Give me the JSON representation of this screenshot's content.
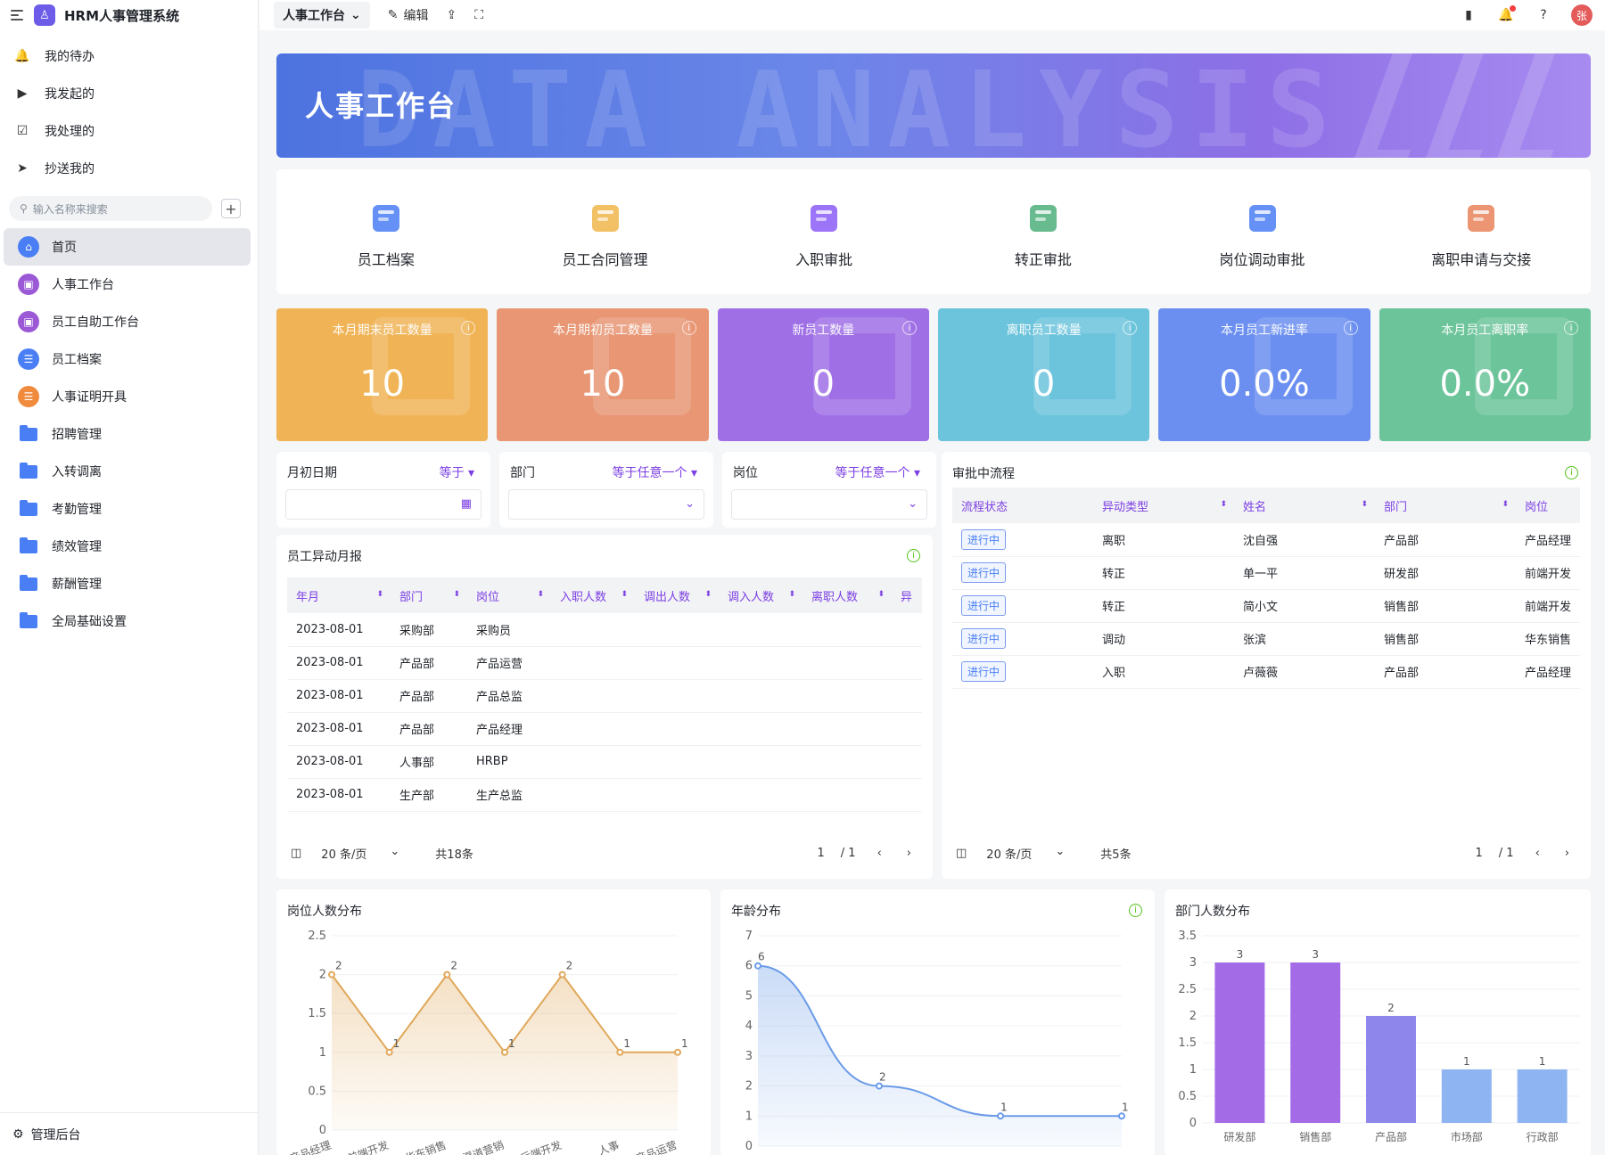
{
  "app": {
    "title": "HRM人事管理系统",
    "logo": "♙"
  },
  "quick": [
    {
      "icon": "bell-icon",
      "glyph": "🔔",
      "label": "我的待办"
    },
    {
      "icon": "play-circle-icon",
      "glyph": "▶",
      "label": "我发起的"
    },
    {
      "icon": "check-calendar-icon",
      "glyph": "☑",
      "label": "我处理的"
    },
    {
      "icon": "send-icon",
      "glyph": "➤",
      "label": "抄送我的"
    }
  ],
  "search": {
    "placeholder": "输入名称来搜索",
    "plus": "+"
  },
  "nav": [
    {
      "label": "首页",
      "icon": "home-icon",
      "glyph": "⌂",
      "color": "#4a7ef5",
      "type": "circle"
    },
    {
      "label": "人事工作台",
      "icon": "workbench-icon",
      "glyph": "▣",
      "color": "#9b59d6",
      "type": "circle"
    },
    {
      "label": "员工自助工作台",
      "icon": "self-service-icon",
      "glyph": "▣",
      "color": "#9b59d6",
      "type": "circle"
    },
    {
      "label": "员工档案",
      "icon": "archive-icon",
      "glyph": "☰",
      "color": "#4a7ef5",
      "type": "circle"
    },
    {
      "label": "人事证明开具",
      "icon": "certificate-icon",
      "glyph": "☰",
      "color": "#f08a3c",
      "type": "circle"
    },
    {
      "label": "招聘管理",
      "icon": "folder-icon",
      "type": "folder"
    },
    {
      "label": "入转调离",
      "icon": "folder-icon",
      "type": "folder"
    },
    {
      "label": "考勤管理",
      "icon": "folder-icon",
      "type": "folder"
    },
    {
      "label": "绩效管理",
      "icon": "folder-icon",
      "type": "folder"
    },
    {
      "label": "薪酬管理",
      "icon": "folder-icon",
      "type": "folder"
    },
    {
      "label": "全局基础设置",
      "icon": "folder-icon",
      "type": "folder"
    }
  ],
  "footer": {
    "label": "管理后台",
    "glyph": "⚙"
  },
  "topbar": {
    "tab": "人事工作台",
    "edit": "编辑",
    "avatar": "张"
  },
  "banner": {
    "title": "人事工作台",
    "bg_text": "DATA ANALYSIS"
  },
  "shortcuts": [
    {
      "label": "员工档案",
      "icon": "employee-archive-icon",
      "color": "#4a7ef5"
    },
    {
      "label": "员工合同管理",
      "icon": "contract-icon",
      "color": "#f0b64a"
    },
    {
      "label": "入职审批",
      "icon": "onboarding-shield-icon",
      "color": "#8b5cf6"
    },
    {
      "label": "转正审批",
      "icon": "regularization-icon",
      "color": "#4caf7a"
    },
    {
      "label": "岗位调动审批",
      "icon": "transfer-doc-icon",
      "color": "#4a7ef5"
    },
    {
      "label": "离职申请与交接",
      "icon": "resignation-icon",
      "color": "#e8835a"
    }
  ],
  "kpis": [
    {
      "label": "本月期末员工数量",
      "value": "10",
      "color": "#f0b457"
    },
    {
      "label": "本月期初员工数量",
      "value": "10",
      "color": "#e89674"
    },
    {
      "label": "新员工数量",
      "value": "0",
      "color": "#9f6fe6"
    },
    {
      "label": "离职员工数量",
      "value": "0",
      "color": "#6cc4dc"
    },
    {
      "label": "本月员工新进率",
      "value": "0.0%",
      "color": "#6b8ff0"
    },
    {
      "label": "本月员工离职率",
      "value": "0.0%",
      "color": "#6cc49a"
    }
  ],
  "filters": [
    {
      "label": "月初日期",
      "op": "等于 ▾",
      "icon": "▦"
    },
    {
      "label": "部门",
      "op": "等于任意一个 ▾",
      "icon": "⌄"
    },
    {
      "label": "岗位",
      "op": "等于任意一个 ▾",
      "icon": "⌄"
    }
  ],
  "report": {
    "title": "员工异动月报",
    "columns": [
      "年月",
      "部门",
      "岗位",
      "入职人数",
      "调出人数",
      "调入人数",
      "离职人数",
      "异"
    ],
    "rows": [
      [
        "2023-08-01",
        "采购部",
        "采购员"
      ],
      [
        "2023-08-01",
        "产品部",
        "产品运营"
      ],
      [
        "2023-08-01",
        "产品部",
        "产品总监"
      ],
      [
        "2023-08-01",
        "产品部",
        "产品经理"
      ],
      [
        "2023-08-01",
        "人事部",
        "HRBP"
      ],
      [
        "2023-08-01",
        "生产部",
        "生产总监"
      ]
    ],
    "pager": {
      "size": "20 条/页",
      "total": "共18条",
      "page": "1",
      "pages": "/ 1"
    }
  },
  "approval": {
    "title": "审批中流程",
    "columns": [
      "流程状态",
      "异动类型",
      "姓名",
      "部门",
      "岗位"
    ],
    "rows": [
      [
        "进行中",
        "离职",
        "沈自强",
        "产品部",
        "产品经理"
      ],
      [
        "进行中",
        "转正",
        "单一平",
        "研发部",
        "前端开发"
      ],
      [
        "进行中",
        "转正",
        "简小文",
        "销售部",
        "前端开发"
      ],
      [
        "进行中",
        "调动",
        "张滨",
        "销售部",
        "华东销售"
      ],
      [
        "进行中",
        "入职",
        "卢薇薇",
        "产品部",
        "产品经理"
      ]
    ],
    "pager": {
      "size": "20 条/页",
      "total": "共5条",
      "page": "1",
      "pages": "/ 1"
    }
  },
  "chart_data": [
    {
      "type": "area",
      "title": "岗位人数分布",
      "categories": [
        "产品经理",
        "前端开发",
        "华东销售",
        "渠道营销",
        "后端开发",
        "人事",
        "产品运营"
      ],
      "values": [
        2,
        1,
        2,
        1,
        2,
        1,
        1
      ],
      "ylim": [
        0,
        2.5
      ],
      "yticks": [
        "0",
        "0.5",
        "1",
        "1.5",
        "2",
        "2.5"
      ],
      "color": "#e0a85a"
    },
    {
      "type": "area",
      "title": "年龄分布",
      "x": [
        0,
        1,
        2,
        3
      ],
      "values": [
        6,
        2,
        1,
        1
      ],
      "ylim": [
        0,
        7
      ],
      "yticks": [
        "0",
        "1",
        "2",
        "3",
        "4",
        "5",
        "6",
        "7"
      ],
      "color": "#6a9be8"
    },
    {
      "type": "bar",
      "title": "部门人数分布",
      "categories": [
        "研发部",
        "销售部",
        "产品部",
        "市场部",
        "行政部"
      ],
      "values": [
        3,
        3,
        2,
        1,
        1
      ],
      "ylim": [
        0,
        3.5
      ],
      "yticks": [
        "0",
        "0.5",
        "1",
        "1.5",
        "2",
        "2.5",
        "3",
        "3.5"
      ],
      "colors": [
        "#a36be6",
        "#a36be6",
        "#8f86ec",
        "#8fb4f2",
        "#8fb4f2"
      ]
    }
  ]
}
